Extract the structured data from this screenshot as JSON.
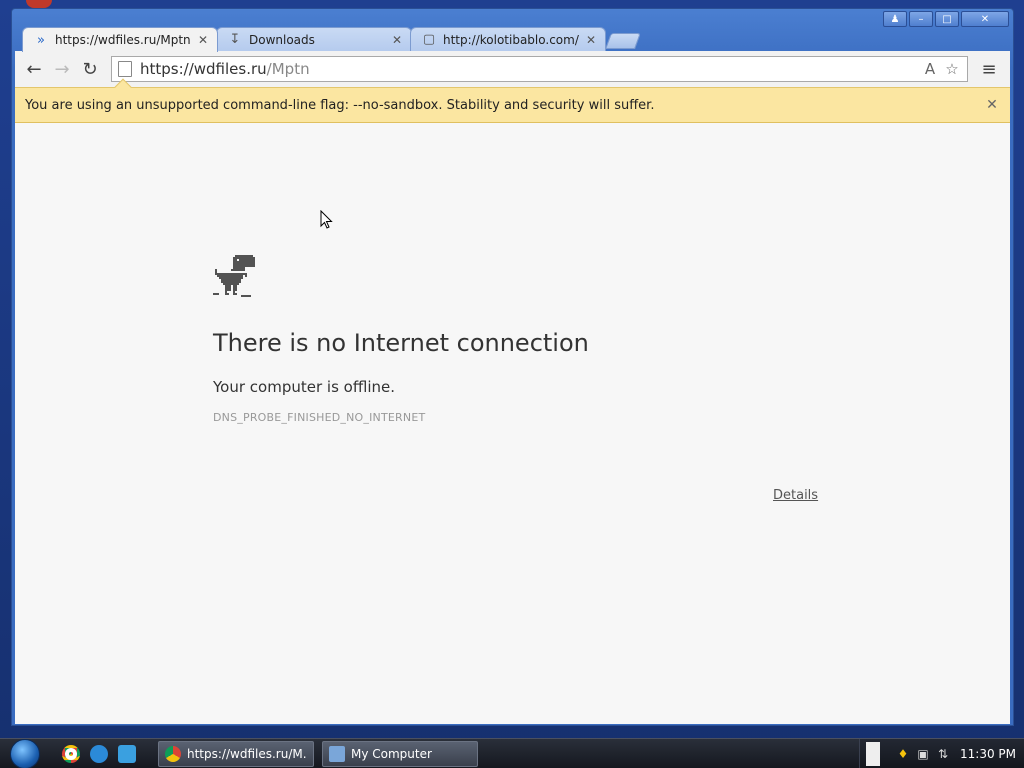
{
  "window": {
    "controls": {
      "user": "♟",
      "minimize": "–",
      "maximize": "□",
      "close": "✕"
    }
  },
  "tabs": [
    {
      "title": "https://wdfiles.ru/Mptn is",
      "icon": "redirect-icon",
      "close": "✕",
      "active": true
    },
    {
      "title": "Downloads",
      "icon": "download-icon",
      "close": "✕",
      "active": false
    },
    {
      "title": "http://kolotibablo.com/ is",
      "icon": "page-icon",
      "close": "✕",
      "active": false
    }
  ],
  "toolbar": {
    "back": "←",
    "forward": "→",
    "reload": "↻",
    "url_host": "https://wdfiles.ru",
    "url_path": "/Mptn",
    "translate": "А",
    "star": "☆",
    "menu": "≡"
  },
  "infobar": {
    "message": "You are using an unsupported command-line flag: --no-sandbox. Stability and security will suffer.",
    "close": "✕",
    "color": "#fbe6a1"
  },
  "error_page": {
    "title": "There is no Internet connection",
    "subtitle": "Your computer is offline.",
    "code": "DNS_PROBE_FINISHED_NO_INTERNET",
    "details_link": "Details"
  },
  "taskbar": {
    "quick_launch": [
      "chrome-icon",
      "ie-icon",
      "media-icon"
    ],
    "buttons": [
      {
        "label": "https://wdfiles.ru/M...",
        "icon": "chrome-icon"
      },
      {
        "label": "My Computer",
        "icon": "computer-icon"
      }
    ],
    "clock": "11:30 PM"
  }
}
